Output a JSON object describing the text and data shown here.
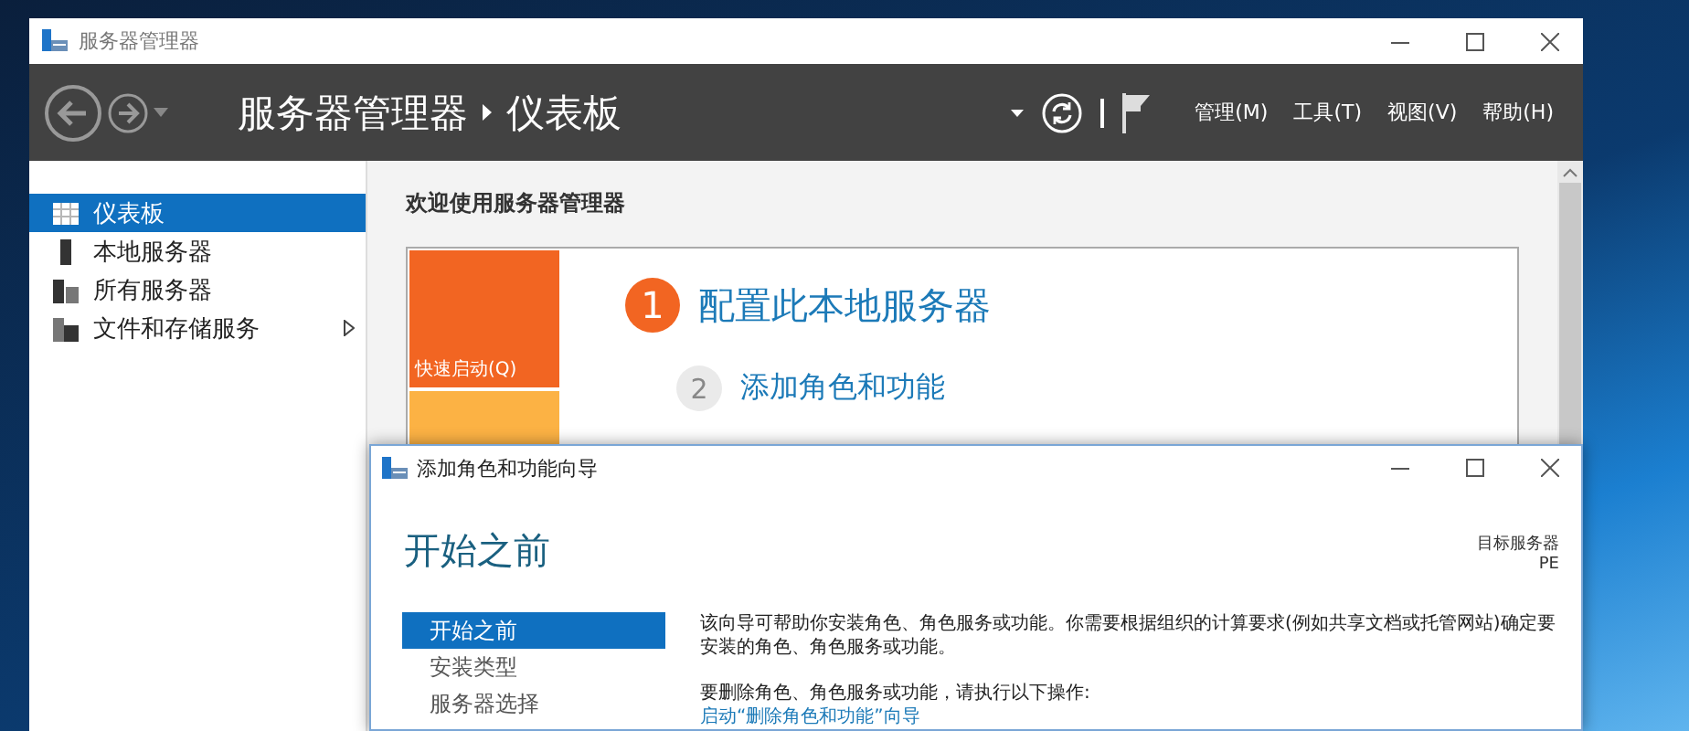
{
  "main_window": {
    "title": "服务器管理器",
    "breadcrumb": [
      "服务器管理器",
      "仪表板"
    ],
    "menu": [
      "管理(M)",
      "工具(T)",
      "视图(V)",
      "帮助(H)"
    ],
    "sidebar": {
      "items": [
        {
          "label": "仪表板",
          "selected": true,
          "expandable": false
        },
        {
          "label": "本地服务器",
          "selected": false,
          "expandable": false
        },
        {
          "label": "所有服务器",
          "selected": false,
          "expandable": false
        },
        {
          "label": "文件和存储服务",
          "selected": false,
          "expandable": true
        }
      ]
    },
    "welcome": {
      "title": "欢迎使用服务器管理器",
      "quick_start": "快速启动(Q)",
      "steps": [
        {
          "number": "1",
          "label": "配置此本地服务器",
          "active": true
        },
        {
          "number": "2",
          "label": "添加角色和功能",
          "active": false
        }
      ]
    }
  },
  "wizard": {
    "title": "添加角色和功能向导",
    "heading": "开始之前",
    "target_label": "目标服务器",
    "target_value": "PE",
    "nav": [
      {
        "label": "开始之前",
        "selected": true
      },
      {
        "label": "安装类型",
        "selected": false
      },
      {
        "label": "服务器选择",
        "selected": false
      }
    ],
    "paragraphs": [
      "该向导可帮助你安装角色、角色服务或功能。你需要根据组织的计算要求(例如共享文档或托管网站)确定要安装的角色、角色服务或功能。",
      "要删除角色、角色服务或功能，请执行以下操作:"
    ],
    "link": "启动“删除角色和功能”向导"
  }
}
